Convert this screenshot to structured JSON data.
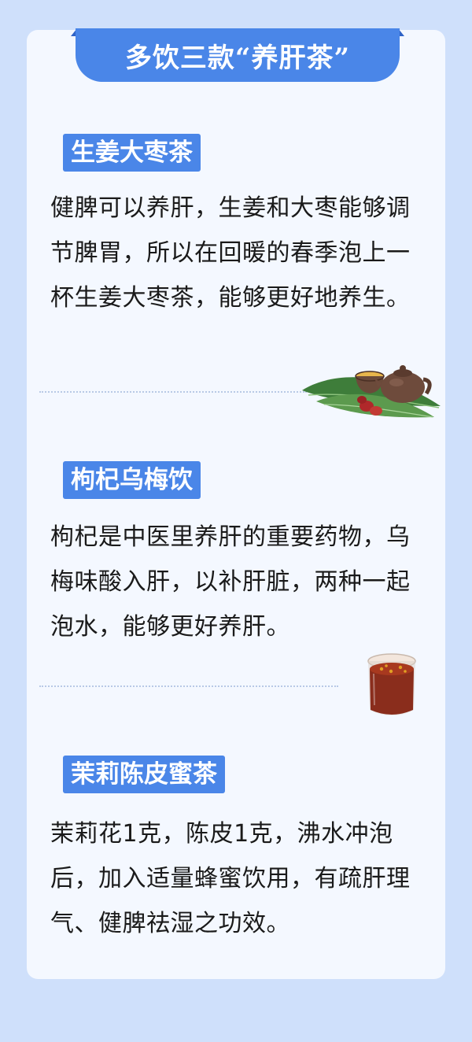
{
  "header": {
    "title": "多饮三款“养肝茶”"
  },
  "sections": [
    {
      "label": "生姜大枣茶",
      "text": "健脾可以养肝，生姜和大枣能够调节脾胃，所以在回暖的春季泡上一杯生姜大枣茶，能够更好地养生。",
      "illustration": "teapot-with-jujube-icon"
    },
    {
      "label": "枸杞乌梅饮",
      "text": "枸杞是中医里养肝的重要药物，乌梅味酸入肝，以补肝脏，两种一起泡水，能够更好养肝。",
      "illustration": "glass-of-tea-icon"
    },
    {
      "label": "茉莉陈皮蜜茶",
      "text": "茉莉花1克，陈皮1克，沸水冲泡后，加入适量蜂蜜饮用，有疏肝理气、健脾祛湿之功效。"
    }
  ],
  "colors": {
    "background": "#cfe0fb",
    "card": "#f4f8ff",
    "accent": "#4a86e8"
  }
}
